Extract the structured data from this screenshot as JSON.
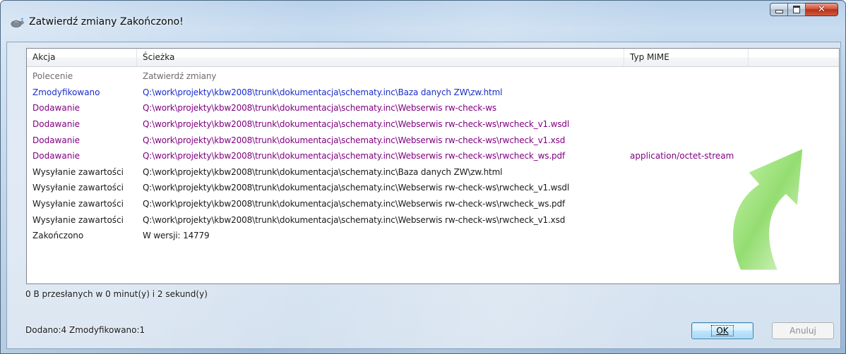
{
  "window": {
    "title": "Zatwierdź zmiany Zakończono!",
    "icon": "tortoise-icon",
    "caption_buttons": {
      "minimize": "minimize-icon",
      "maximize": "maximize-icon",
      "close": "✕"
    }
  },
  "list": {
    "columns": [
      "Akcja",
      "Ścieżka",
      "Typ MIME",
      ""
    ],
    "rows": [
      {
        "action": "Polecenie",
        "path": "Zatwierdź zmiany",
        "mime": "",
        "color": "#6d6d6d"
      },
      {
        "action": "Zmodyfikowano",
        "path": "Q:\\work\\projekty\\kbw2008\\trunk\\dokumentacja\\schematy.inc\\Baza danych ZW\\zw.html",
        "mime": "",
        "color": "#1a2ec9"
      },
      {
        "action": "Dodawanie",
        "path": "Q:\\work\\projekty\\kbw2008\\trunk\\dokumentacja\\schematy.inc\\Webserwis rw-check-ws",
        "mime": "",
        "color": "#800080"
      },
      {
        "action": "Dodawanie",
        "path": "Q:\\work\\projekty\\kbw2008\\trunk\\dokumentacja\\schematy.inc\\Webserwis rw-check-ws\\rwcheck_v1.wsdl",
        "mime": "",
        "color": "#800080"
      },
      {
        "action": "Dodawanie",
        "path": "Q:\\work\\projekty\\kbw2008\\trunk\\dokumentacja\\schematy.inc\\Webserwis rw-check-ws\\rwcheck_v1.xsd",
        "mime": "",
        "color": "#800080"
      },
      {
        "action": "Dodawanie",
        "path": "Q:\\work\\projekty\\kbw2008\\trunk\\dokumentacja\\schematy.inc\\Webserwis rw-check-ws\\rwcheck_ws.pdf",
        "mime": "application/octet-stream",
        "color": "#800080"
      },
      {
        "action": "Wysyłanie zawartości",
        "path": "Q:\\work\\projekty\\kbw2008\\trunk\\dokumentacja\\schematy.inc\\Baza danych ZW\\zw.html",
        "mime": "",
        "color": "#1a1a1a"
      },
      {
        "action": "Wysyłanie zawartości",
        "path": "Q:\\work\\projekty\\kbw2008\\trunk\\dokumentacja\\schematy.inc\\Webserwis rw-check-ws\\rwcheck_v1.wsdl",
        "mime": "",
        "color": "#1a1a1a"
      },
      {
        "action": "Wysyłanie zawartości",
        "path": "Q:\\work\\projekty\\kbw2008\\trunk\\dokumentacja\\schematy.inc\\Webserwis rw-check-ws\\rwcheck_ws.pdf",
        "mime": "",
        "color": "#1a1a1a"
      },
      {
        "action": "Wysyłanie zawartości",
        "path": "Q:\\work\\projekty\\kbw2008\\trunk\\dokumentacja\\schematy.inc\\Webserwis rw-check-ws\\rwcheck_v1.xsd",
        "mime": "",
        "color": "#1a1a1a"
      },
      {
        "action": "Zakończono",
        "path": "W wersji: 14779",
        "mime": "",
        "color": "#1a1a1a"
      }
    ]
  },
  "status": {
    "transfer": "0 B przesłanych w 0 minut(y) i 2 sekund(y)",
    "summary": "Dodano:4 Zmodyfikowano:1"
  },
  "buttons": {
    "ok": "OK",
    "cancel": "Anuluj"
  },
  "watermark": {
    "icon": "green-curved-arrow-icon",
    "color": "#8fdc6a"
  }
}
